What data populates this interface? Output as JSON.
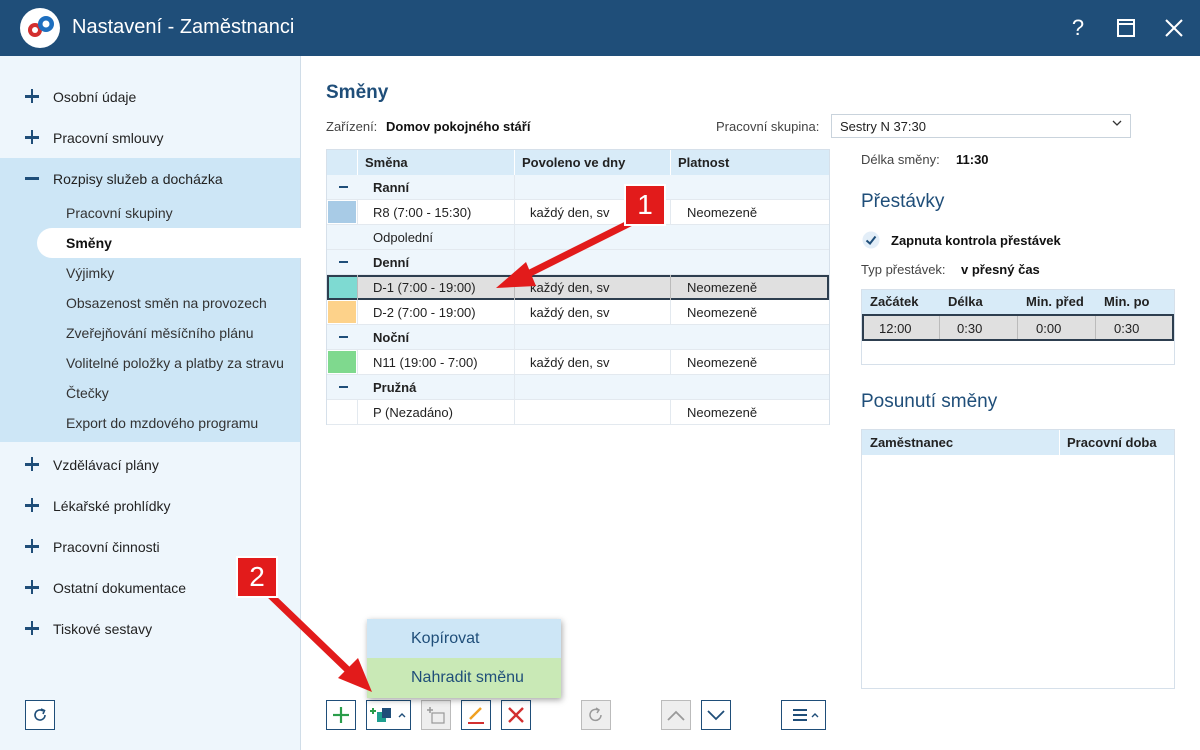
{
  "window": {
    "title": "Nastavení - Zaměstnanci",
    "help": "?",
    "maximize": "☐",
    "close": "✕"
  },
  "sidebar": {
    "items": [
      {
        "label": "Osobní údaje",
        "expanded": false
      },
      {
        "label": "Pracovní smlouvy",
        "expanded": false
      },
      {
        "label": "Rozpisy služeb a docházka",
        "expanded": true
      },
      {
        "label": "Vzdělávací plány",
        "expanded": false
      },
      {
        "label": "Lékařské prohlídky",
        "expanded": false
      },
      {
        "label": "Pracovní činnosti",
        "expanded": false
      },
      {
        "label": "Ostatní dokumentace",
        "expanded": false
      },
      {
        "label": "Tiskové sestavy",
        "expanded": false
      }
    ],
    "subitems": [
      "Pracovní skupiny",
      "Směny",
      "Výjimky",
      "Obsazenost směn na provozech",
      "Zveřejňování měsíčního plánu",
      "Volitelné položky a platby za stravu",
      "Čtečky",
      "Export do mzdového programu"
    ],
    "active_subitem": "Směny"
  },
  "main": {
    "title": "Směny",
    "facility_label": "Zařízení:",
    "facility_value": "Domov pokojného stáří",
    "group_label": "Pracovní skupina:",
    "group_value": "Sestry N 37:30"
  },
  "grid": {
    "columns": [
      "Směna",
      "Povoleno ve dny",
      "Platnost"
    ],
    "rows": [
      {
        "type": "group",
        "name": "Ranní"
      },
      {
        "type": "item",
        "name": "R8 (7:00 - 15:30)",
        "days": "každý den, sv",
        "validity": "Neomezeně",
        "color": "#a8cbe6"
      },
      {
        "type": "plain",
        "name": "Odpolední"
      },
      {
        "type": "group",
        "name": "Denní"
      },
      {
        "type": "item",
        "name": "D-1 (7:00 - 19:00)",
        "days": "každý den, sv",
        "validity": "Neomezeně",
        "color": "#7edad2",
        "selected": true
      },
      {
        "type": "item",
        "name": "D-2 (7:00 - 19:00)",
        "days": "každý den, sv",
        "validity": "Neomezeně",
        "color": "#fdd28a"
      },
      {
        "type": "group",
        "name": "Noční"
      },
      {
        "type": "item",
        "name": "N11 (19:00 - 7:00)",
        "days": "každý den, sv",
        "validity": "Neomezeně",
        "color": "#7fd98e"
      },
      {
        "type": "group",
        "name": "Pružná"
      },
      {
        "type": "item",
        "name": "P (Nezadáno)",
        "days": "",
        "validity": "Neomezeně",
        "color": ""
      }
    ]
  },
  "details": {
    "shift_length_label": "Délka směny:",
    "shift_length_value": "11:30",
    "breaks_title": "Přestávky",
    "breaks_check_label": "Zapnuta kontrola přestávek",
    "break_type_label": "Typ přestávek:",
    "break_type_value": "v přesný čas",
    "breaks_columns": [
      "Začátek",
      "Délka",
      "Min. před",
      "Min. po"
    ],
    "breaks_row": [
      "12:00",
      "0:30",
      "0:00",
      "0:30"
    ],
    "shift_move_title": "Posunutí směny",
    "shift_move_columns": [
      "Zaměstnanec",
      "Pracovní doba"
    ]
  },
  "menu": {
    "items": [
      "Kopírovat",
      "Nahradit směnu"
    ]
  },
  "annotations": {
    "callout1": "1",
    "callout2": "2"
  },
  "colors": {
    "brand": "#1f4e79",
    "accent_red": "#e21b1b",
    "menu_highlight": "#c9e9b6",
    "menu_hover": "#cde6f6"
  }
}
